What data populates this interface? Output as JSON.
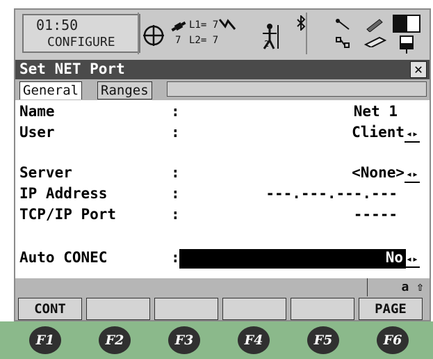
{
  "status": {
    "time": "01:50",
    "mode": "CONFIGURE",
    "l1": "L1= 7",
    "l2": "L2= 7",
    "sats": "7",
    "rover_index": "2",
    "icons": [
      "crosshair-icon",
      "satellite-icon",
      "rover-icon",
      "bluetooth-icon",
      "interface-icon",
      "pen-icon",
      "battery-icon",
      "memory-card-icon"
    ]
  },
  "title": "Set NET Port",
  "tabs": [
    {
      "label": "General",
      "active": true
    },
    {
      "label": "Ranges",
      "active": false
    }
  ],
  "fields": {
    "name": {
      "label": "Name",
      "value": "Net 1"
    },
    "user": {
      "label": "User",
      "value": "Client"
    },
    "server": {
      "label": "Server",
      "value": "<None>"
    },
    "ip": {
      "label": "IP Address",
      "value": "---.---.---.---"
    },
    "port": {
      "label": "TCP/IP Port",
      "value": "-----"
    },
    "auto": {
      "label": "Auto CONEC",
      "value": "No"
    }
  },
  "colon": ":",
  "shift_indicator": "a ⇧",
  "softkeys": [
    "CONT",
    "",
    "",
    "",
    "",
    "PAGE"
  ],
  "fkeys": [
    "F1",
    "F2",
    "F3",
    "F4",
    "F5",
    "F6"
  ],
  "colors": {
    "title_bar": "#4a4a4a",
    "highlight": "#000000",
    "fkey_strip": "#8bb98b"
  }
}
